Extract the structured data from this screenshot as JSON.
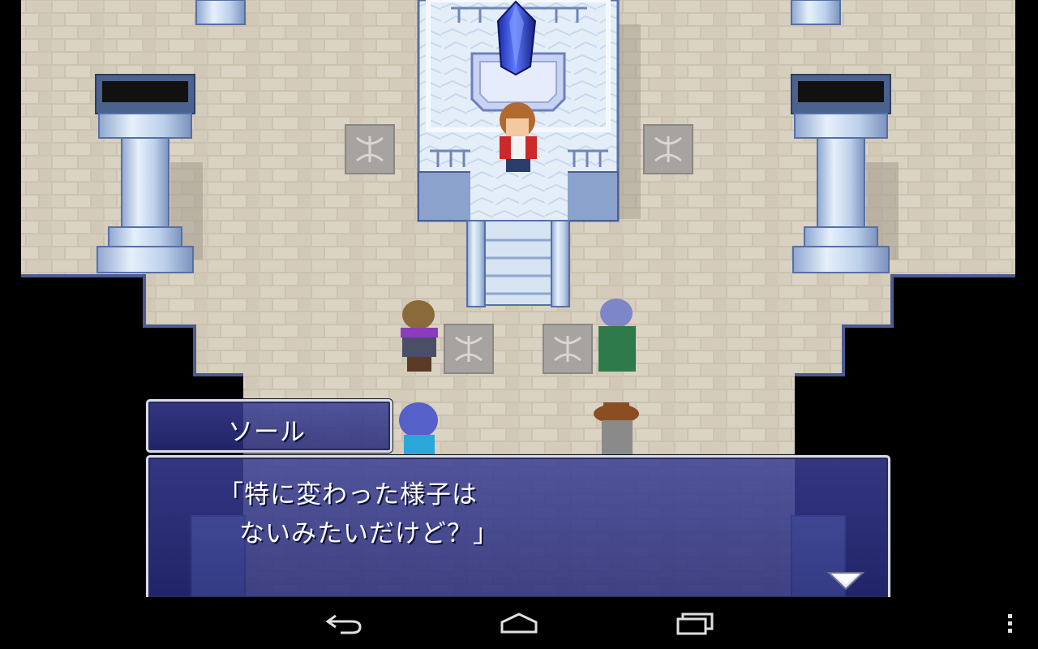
{
  "dialogue": {
    "speaker": "ソール",
    "lines": [
      "「特に変わった様子は",
      "ないみたいだけど？」"
    ]
  },
  "icons": {
    "advance": "down-triangle-icon",
    "back": "back-arrow-icon",
    "home": "home-icon",
    "recents": "recent-apps-icon",
    "menu": "overflow-menu-icon"
  },
  "colors": {
    "window_fill": "#3c4096",
    "window_border": "#d8dcef",
    "floor": "#c9bfad",
    "crystal": "#2a3fd6",
    "ice": "#bfd6f0"
  }
}
